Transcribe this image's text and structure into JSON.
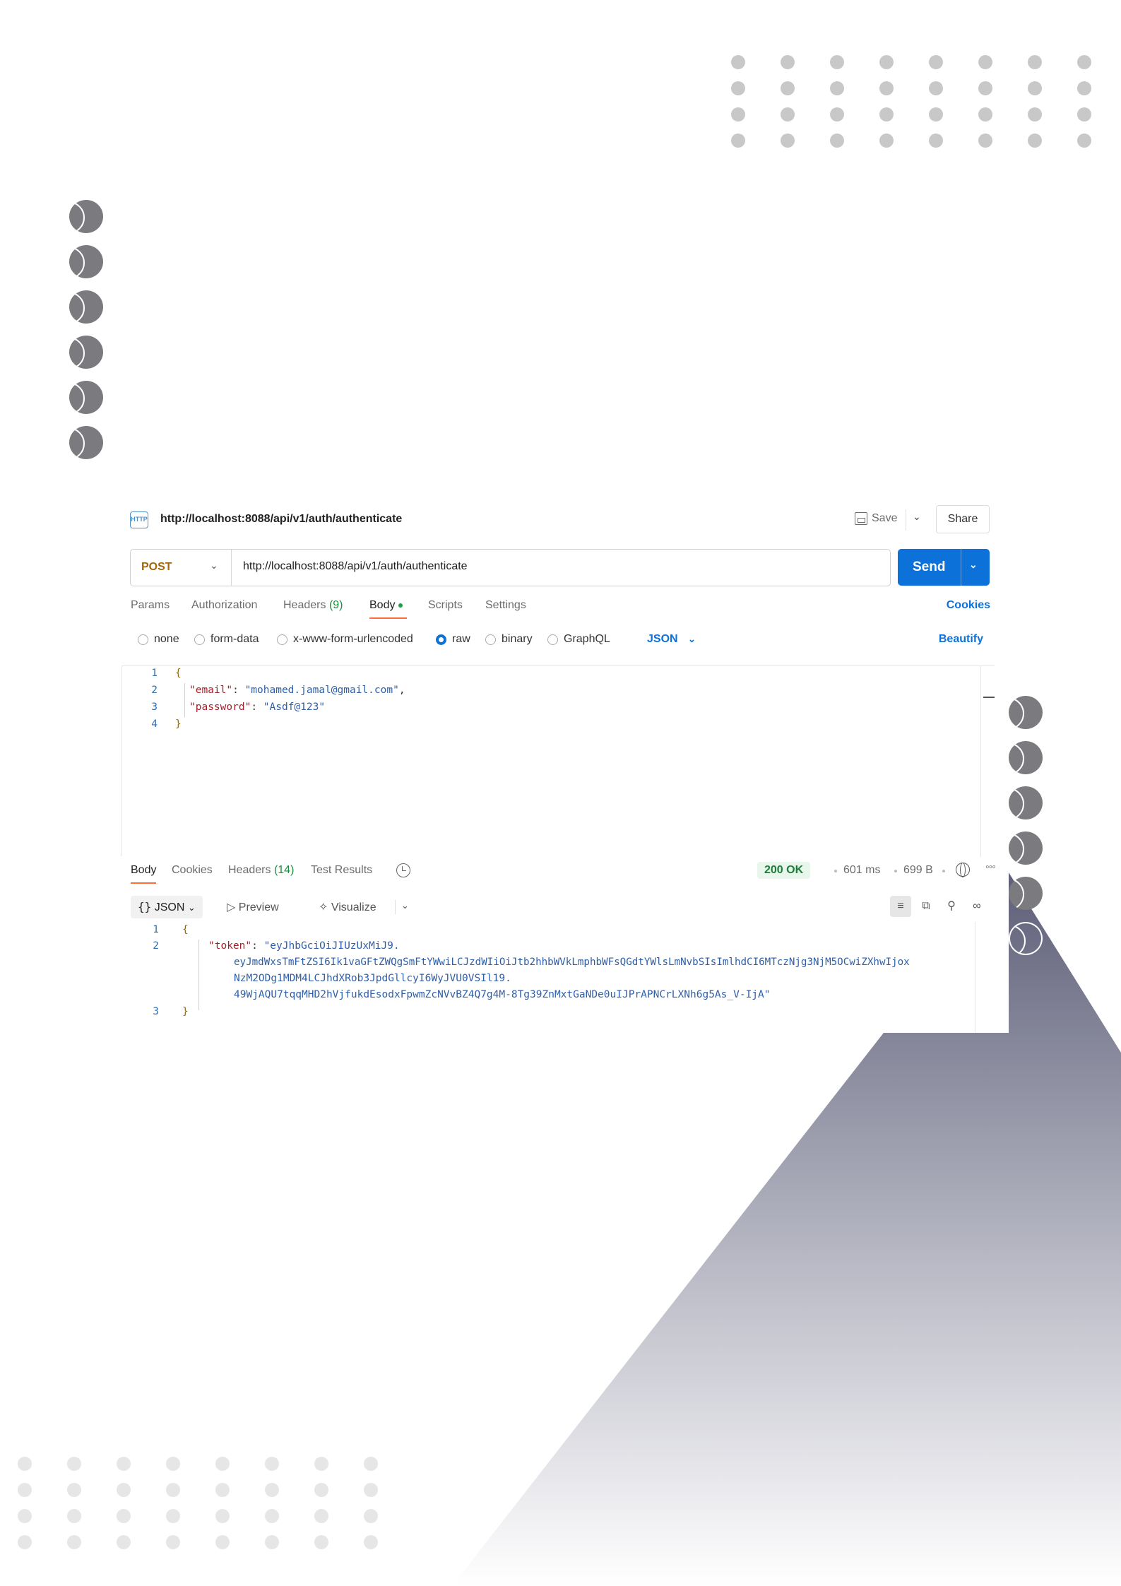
{
  "request": {
    "tab_title": "http://localhost:8088/api/v1/auth/authenticate",
    "http_icon_text": "HTTP",
    "save_label": "Save",
    "share_label": "Share",
    "method": "POST",
    "url": "http://localhost:8088/api/v1/auth/authenticate",
    "send_label": "Send",
    "tabs": [
      {
        "label": "Params"
      },
      {
        "label": "Authorization"
      },
      {
        "label": "Headers",
        "count": "(9)"
      },
      {
        "label": "Body",
        "active": true
      },
      {
        "label": "Scripts"
      },
      {
        "label": "Settings"
      }
    ],
    "cookies_label": "Cookies",
    "body_modes": [
      "none",
      "form-data",
      "x-www-form-urlencoded",
      "raw",
      "binary",
      "GraphQL"
    ],
    "body_mode_selected": "raw",
    "language": "JSON",
    "beautify_label": "Beautify",
    "body_lines": [
      {
        "n": "1",
        "open": "{"
      },
      {
        "n": "2",
        "key": "\"email\"",
        "sep": ": ",
        "value": "\"mohamed.jamal@gmail.com\"",
        "tail": ","
      },
      {
        "n": "3",
        "key": "\"password\"",
        "sep": ": ",
        "value": "\"Asdf@123\"",
        "tail": ""
      },
      {
        "n": "4",
        "close": "}"
      }
    ]
  },
  "response": {
    "tabs": [
      {
        "label": "Body",
        "active": true
      },
      {
        "label": "Cookies"
      },
      {
        "label": "Headers",
        "count": "(14)"
      },
      {
        "label": "Test Results"
      }
    ],
    "status": "200 OK",
    "time": "601 ms",
    "size": "699 B",
    "format": "JSON",
    "preview_label": "Preview",
    "visualize_label": "Visualize",
    "line_numbers": [
      "1",
      "2",
      "3"
    ],
    "open_brace": "{",
    "close_brace": "}",
    "token_key": "\"token\"",
    "token_sep": ": ",
    "token_lines": [
      "\"eyJhbGciOiJIUzUxMiJ9.",
      "eyJmdWxsTmFtZSI6Ik1vaGFtZWQgSmFtYWwiLCJzdWIiOiJtb2hhbWVkLmphbWFsQGdtYWlsLmNvbSIsImlhdCI6MTczNjg3NjM5OCwiZXhwIjox",
      "NzM2ODg1MDM4LCJhdXRob3JpdGllcyI6WyJVU0VSIl19.",
      "49WjAQU7tqqMHD2hVjfukdEsodxFpwmZcNVvBZ4Q7g4M-8Tg39ZnMxtGaNDe0uIJPrAPNCrLXNh6g5As_V-IjA\""
    ]
  },
  "colors": {
    "accent": "#0d71da",
    "method": "#a4660a",
    "active_tab_underline": "#ff6c37",
    "status_ok_bg": "#e8f6ec",
    "status_ok_text": "#1d7d38"
  }
}
